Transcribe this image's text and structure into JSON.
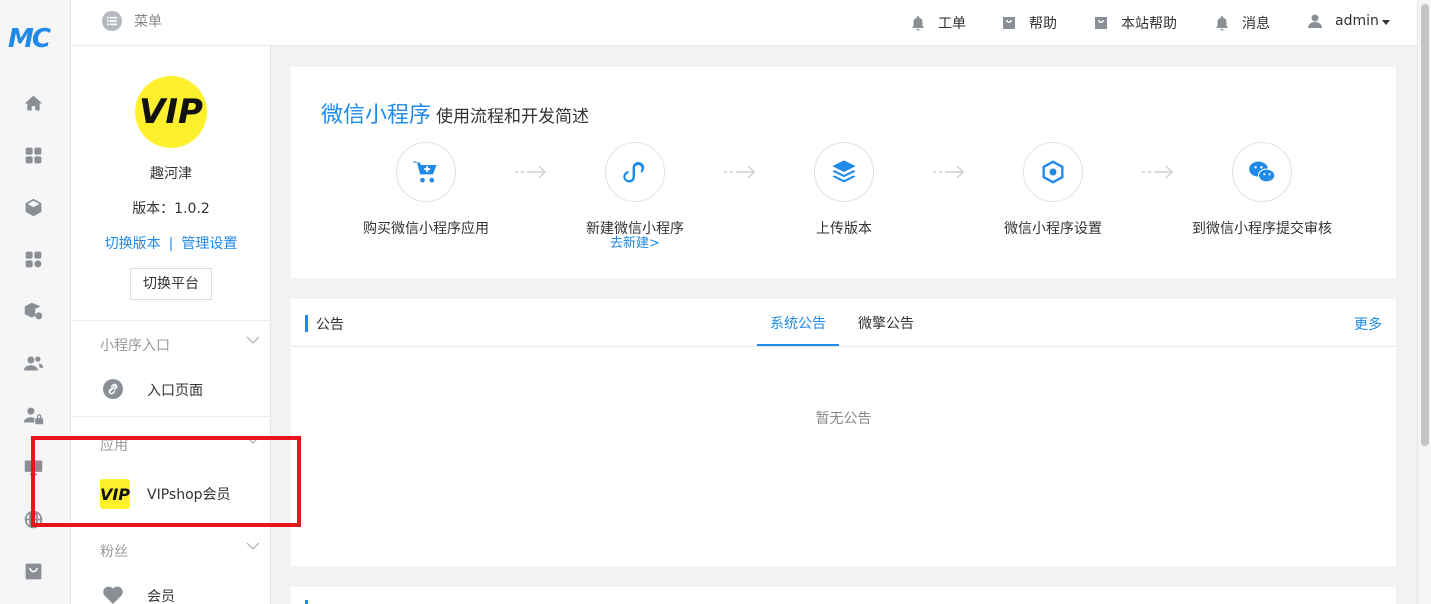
{
  "app": {
    "logo_text": "MC"
  },
  "rail": {
    "icons": [
      "home-icon",
      "apps-grid-icon",
      "box-icon",
      "app-settings-icon",
      "package-settings-icon",
      "users-icon",
      "user-lock-icon",
      "monitor-icon",
      "globe-icon",
      "store-bag-icon"
    ]
  },
  "topbar": {
    "menu_label": "菜单",
    "items": [
      {
        "icon": "bell-icon",
        "label": "工单"
      },
      {
        "icon": "bag-icon",
        "label": "帮助"
      },
      {
        "icon": "bag-icon",
        "label": "本站帮助"
      },
      {
        "icon": "bell-icon",
        "label": "消息"
      },
      {
        "icon": "user-icon",
        "label": "admin"
      }
    ]
  },
  "account": {
    "avatar_text": "VIP",
    "name": "趣河津",
    "version": "版本：1.0.2",
    "switch_version": "切换版本",
    "separator": "|",
    "manage_settings": "管理设置",
    "switch_platform": "切换平台"
  },
  "sidebar": {
    "sections": [
      {
        "title": "小程序入口",
        "items": [
          {
            "label": "入口页面",
            "icon": "link-icon"
          }
        ]
      },
      {
        "title": "应用",
        "items": [
          {
            "label": "VIPshop会员",
            "icon": "vip-icon",
            "icon_text": "VIP"
          }
        ]
      },
      {
        "title": "粉丝",
        "items": [
          {
            "label": "会员",
            "icon": "heart-icon"
          }
        ]
      }
    ]
  },
  "flow": {
    "title_main": "微信小程序",
    "title_sub": "使用流程和开发简述",
    "steps": [
      {
        "icon": "cart-icon",
        "label": "购买微信小程序应用",
        "link": ""
      },
      {
        "icon": "miniprogram-icon",
        "label": "新建微信小程序",
        "link": "去新建>"
      },
      {
        "icon": "layers-icon",
        "label": "上传版本",
        "link": ""
      },
      {
        "icon": "hexagon-icon",
        "label": "微信小程序设置",
        "link": ""
      },
      {
        "icon": "wechat-icon",
        "label": "到微信小程序提交审核",
        "link": ""
      }
    ]
  },
  "announcements": {
    "title": "公告",
    "tabs": [
      "系统公告",
      "微擎公告"
    ],
    "active_tab": 0,
    "more": "更多",
    "empty_text": "暂无公告"
  },
  "colors": {
    "accent": "#1f8ae8",
    "highlight": "#e8141b",
    "vip_yellow": "#fff02e"
  }
}
